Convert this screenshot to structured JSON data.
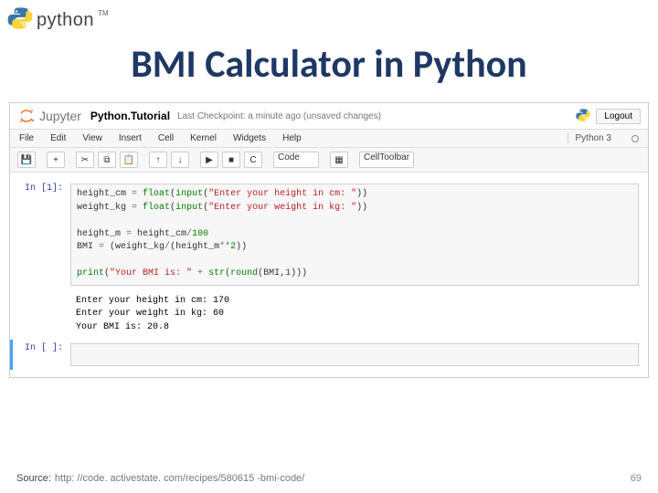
{
  "python_brand": {
    "wordmark": "python",
    "tm": "TM"
  },
  "slide_title": "BMI Calculator in Python",
  "jupyter": {
    "brand": "Jupyter",
    "notebook_name": "Python.Tutorial",
    "checkpoint": "Last Checkpoint: a minute ago (unsaved changes)",
    "logout": "Logout",
    "menu": {
      "file": "File",
      "edit": "Edit",
      "view": "View",
      "insert": "Insert",
      "cell": "Cell",
      "kernel": "Kernel",
      "widgets": "Widgets",
      "help": "Help",
      "kernel_name": "Python 3"
    },
    "toolbar": {
      "save": "💾",
      "add": "+",
      "cut": "✂",
      "copy": "⧉",
      "paste": "📋",
      "up": "↑",
      "down": "↓",
      "run": "▶",
      "stop": "■",
      "restart": "C",
      "celltype": "Code",
      "cmd": "▦",
      "celltoolbar": "CellToolbar"
    },
    "cell1_prompt": "In [1]:",
    "cell2_prompt": "In [ ]:",
    "code": {
      "l1_a": "height_cm ",
      "l1_eq": "= ",
      "l1_b": "float",
      "l1_c": "(",
      "l1_d": "input",
      "l1_e": "(",
      "l1_f": "\"Enter your height in cm: \"",
      "l1_g": "))",
      "l2_a": "weight_kg ",
      "l2_eq": "= ",
      "l2_b": "float",
      "l2_c": "(",
      "l2_d": "input",
      "l2_e": "(",
      "l2_f": "\"Enter your weight in kg: \"",
      "l2_g": "))",
      "blank": "",
      "l3": "height_m ",
      "l3_eq": "= ",
      "l3_b": "height_cm",
      "l3_c": "/",
      "l3_d": "100",
      "l4_a": "BMI ",
      "l4_eq": "= ",
      "l4_b": "(weight_kg",
      "l4_c": "/",
      "l4_d": "(height_m",
      "l4_e": "**",
      "l4_f": "2",
      "l4_g": "))",
      "l5_a": "print",
      "l5_b": "(",
      "l5_c": "\"Your BMI is: \"",
      "l5_d": " + ",
      "l5_e": "str",
      "l5_f": "(",
      "l5_g": "round",
      "l5_h": "(BMI,",
      "l5_i": "1",
      "l5_j": ")))"
    },
    "output": "Enter your height in cm: 170\nEnter your weight in kg: 60\nYour BMI is: 20.8"
  },
  "footer": {
    "label": "Source:",
    "url": "http: //code. activestate. com/recipes/580615 -bmi-code/",
    "page": "69"
  }
}
